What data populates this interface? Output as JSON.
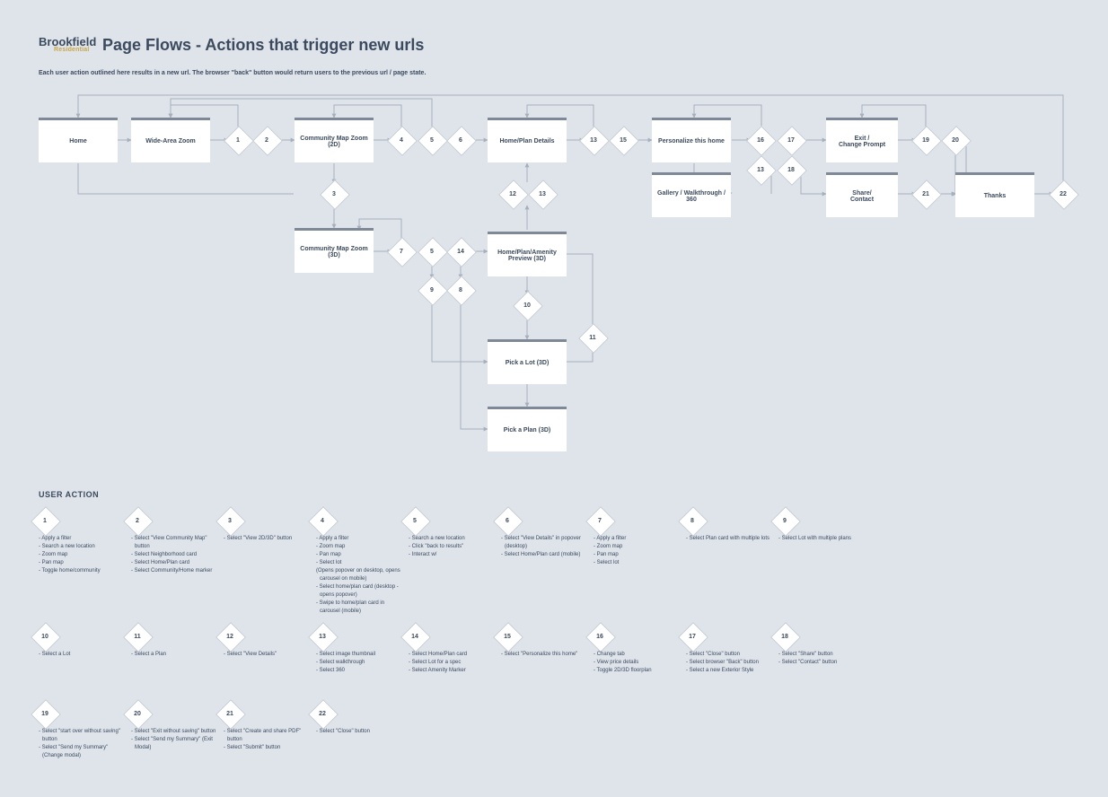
{
  "brand": {
    "name": "Brookfield",
    "sub": "Residential"
  },
  "title": "Page Flows - Actions that trigger new urls",
  "subtitle": "Each user action outlined here results in a new url. The browser \"back\" button would return users to the previous url / page state.",
  "section": "USER ACTION",
  "boxes": {
    "home": "Home",
    "wide": "Wide-Area Zoom",
    "cmz2d": "Community Map Zoom (2D)",
    "cmz3d": "Community Map Zoom (3D)",
    "hpd": "Home/Plan Details",
    "hpap": "Home/Plan/Amenity Preview (3D)",
    "picklot": "Pick a Lot (3D)",
    "pickplan": "Pick a Plan (3D)",
    "personalize": "Personalize this home",
    "gallery": "Gallery / Walkthrough / 360",
    "exit": "Exit /\nChange Prompt",
    "share": "Share/\nContact",
    "thanks": "Thanks"
  },
  "d": {
    "1": "1",
    "2": "2",
    "3": "3",
    "4": "4",
    "5": "5",
    "6": "6",
    "7": "7",
    "8": "8",
    "9": "9",
    "10": "10",
    "11": "11",
    "12": "12",
    "13": "13",
    "14": "14",
    "15": "15",
    "16": "16",
    "17": "17",
    "18": "18",
    "19": "19",
    "20": "20",
    "21": "21",
    "22": "22"
  },
  "actions": {
    "1": [
      "- Apply a filter",
      "- Search a new location",
      "- Zoom map",
      "- Pan map",
      "- Toggle home/community"
    ],
    "2": [
      "- Select \"View Community Map\" button",
      "- Select Neighborhood card",
      "- Select Home/Plan card",
      "- Select Community/Home marker"
    ],
    "3": [
      "- Select \"View 2D/3D\" button"
    ],
    "4": [
      "- Apply a filter",
      "- Zoom map",
      "- Pan map",
      "- Select lot",
      "(Opens popover on desktop, opens carousel on mobile)",
      "- Select home/plan card  (desktop - opens popover)",
      "- Swipe to home/plan card in carousel (mobile)"
    ],
    "5": [
      "- Search a new location",
      "- Click \"back to results\"",
      "- Interact w/"
    ],
    "6": [
      "- Select \"View Details\" in popover (desktop)",
      "- Select Home/Plan card (mobile)"
    ],
    "7": [
      "- Apply a filter",
      "- Zoom map",
      "- Pan map",
      "- Select lot"
    ],
    "8": [
      "- Select Plan card with multiple lots"
    ],
    "9": [
      "- Select Lot with multiple plans"
    ],
    "10": [
      "- Select a Lot"
    ],
    "11": [
      "- Select a Plan"
    ],
    "12": [
      "- Select \"View Details\""
    ],
    "13": [
      "- Select image thumbnail",
      "- Select walkthrough",
      "- Select 360"
    ],
    "14": [
      "- Select Home/Plan card",
      "- Select Lot for a spec",
      "- Select Amenity Marker"
    ],
    "15": [
      "- Select \"Personalize this home\""
    ],
    "16": [
      "- Change tab",
      "- View price details",
      "- Toggle 2D/3D floorplan"
    ],
    "17": [
      "- Select \"Close\" button",
      "- Select browser \"Back\" button",
      "- Select a new Exterior Style"
    ],
    "18": [
      "- Select \"Share\" button",
      "- Select \"Contact\" button"
    ],
    "19": [
      "- Select \"start over without saving\" button",
      "- Select \"Send my Summary\" (Change modal)"
    ],
    "20": [
      "- Select \"Exit without saving\" button",
      "- Select \"Send my Summary\" (Exit Modal)"
    ],
    "21": [
      "- Select \"Create and share PDF\" button",
      "- Select \"Submit\" button"
    ],
    "22": [
      "- Select \"Close\" button"
    ]
  }
}
